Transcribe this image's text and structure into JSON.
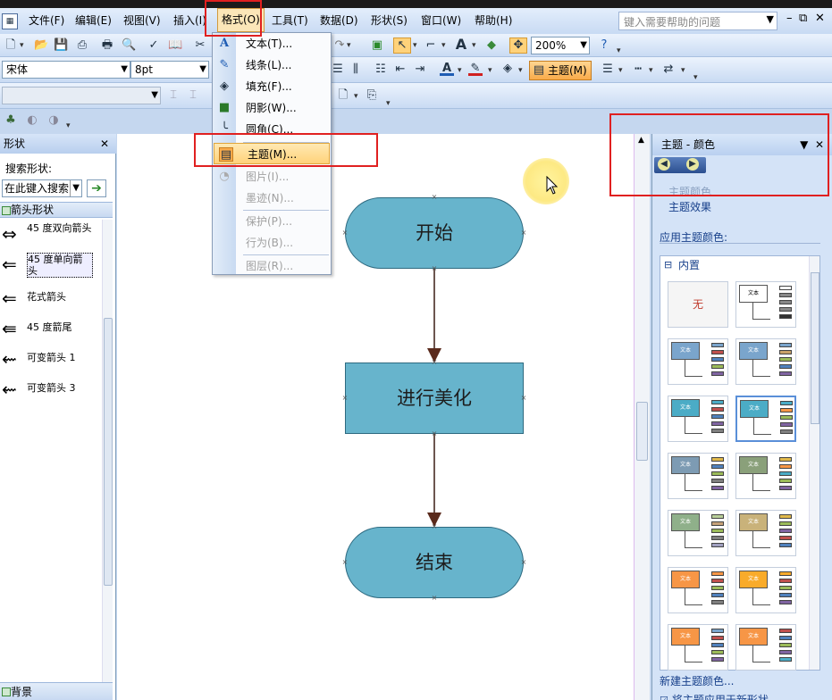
{
  "menubar": {
    "items": [
      "文件(F)",
      "编辑(E)",
      "视图(V)",
      "插入(I)",
      "格式(O)",
      "工具(T)",
      "数据(D)",
      "形状(S)",
      "窗口(W)",
      "帮助(H)"
    ],
    "help_placeholder": "键入需要帮助的问题"
  },
  "toolbar": {
    "zoom": "200%",
    "font": "宋体",
    "size": "8pt",
    "theme_label": "主题(M)"
  },
  "format_menu": {
    "items": [
      {
        "label": "文本(T)...",
        "icon": "text-a-icon",
        "disabled": false
      },
      {
        "label": "线条(L)...",
        "icon": "pen-line-icon",
        "disabled": false
      },
      {
        "label": "填充(F)...",
        "icon": "paint-bucket-icon",
        "disabled": false
      },
      {
        "label": "阴影(W)...",
        "icon": "shadow-box-icon",
        "disabled": false
      },
      {
        "label": "圆角(C)...",
        "icon": "round-corner-icon",
        "disabled": false
      },
      {
        "label": "主题(M)...",
        "icon": "theme-icon",
        "disabled": false,
        "highlighted": true
      },
      {
        "label": "图片(I)...",
        "icon": "picture-icon",
        "disabled": true
      },
      {
        "label": "墨迹(N)...",
        "icon": "",
        "disabled": true
      },
      {
        "label": "保护(P)...",
        "icon": "",
        "disabled": true
      },
      {
        "label": "行为(B)...",
        "icon": "",
        "disabled": true
      },
      {
        "label": "图层(R)...",
        "icon": "",
        "disabled": true
      }
    ]
  },
  "shapes_panel": {
    "title": "形状",
    "search_label": "搜索形状:",
    "search_placeholder": "在此键入搜索",
    "stencil": "箭头形状",
    "items": [
      "45 度双向箭头",
      "45 度单向箭头",
      "花式箭头",
      "45 度箭尾",
      "可变箭头 1",
      "可变箭头 3"
    ],
    "background_stencil": "背景"
  },
  "canvas": {
    "nodes": [
      "开始",
      "进行美化",
      "结束"
    ]
  },
  "theme_panel": {
    "title": "主题 - 颜色",
    "link_colors": "主题颜色",
    "link_effects": "主题效果",
    "apply_label": "应用主题颜色:",
    "builtin_label": "内置",
    "none_label": "无",
    "thumb_text": "文本",
    "new_colors": "新建主题颜色...",
    "apply_new": "将主题应用于新形状"
  },
  "colors": {
    "node_fill": "#67b4cc",
    "highlight_red": "#e02020",
    "menu_hover": "#ffd27a"
  }
}
